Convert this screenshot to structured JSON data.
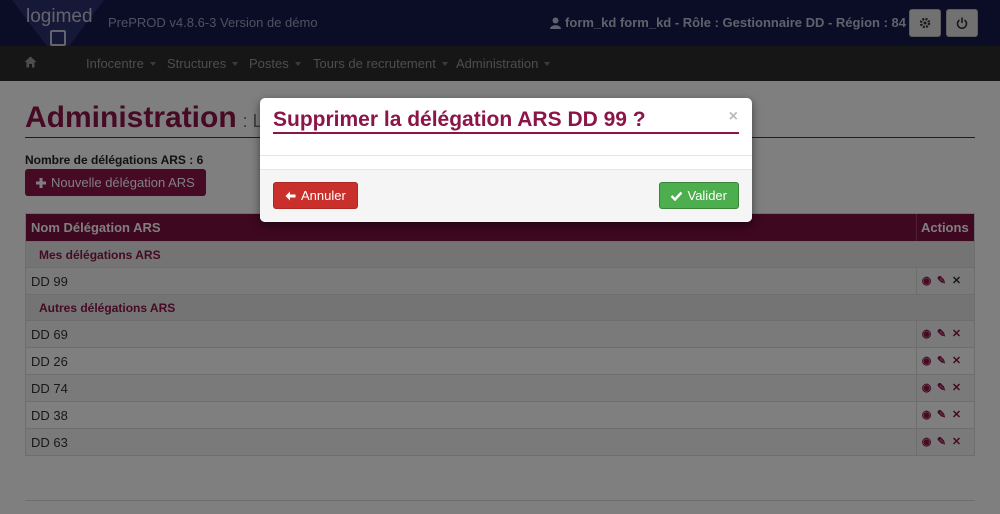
{
  "header": {
    "logo_text": "logimed",
    "version": "PrePROD v4.8.6-3 Version de démo",
    "user_info": "form_kd form_kd - Rôle : Gestionnaire DD - Région : 84",
    "settings_icon": "gear-icon",
    "logout_icon": "power-icon"
  },
  "nav": {
    "home_icon": "home-icon",
    "items": [
      {
        "label": "Infocentre"
      },
      {
        "label": "Structures"
      },
      {
        "label": "Postes"
      },
      {
        "label": "Tours de recrutement"
      },
      {
        "label": "Administration"
      }
    ]
  },
  "page": {
    "title": "Administration",
    "subtitle": ": Lis",
    "count_label": "Nombre de délégations ARS : 6",
    "new_button": "Nouvelle délégation ARS"
  },
  "table": {
    "headers": {
      "name": "Nom Délégation ARS",
      "actions": "Actions"
    },
    "groups": [
      {
        "label": "Mes délégations ARS",
        "rows": [
          "DD 99"
        ]
      },
      {
        "label": "Autres délégations ARS",
        "rows": [
          "DD 69",
          "DD 26",
          "DD 74",
          "DD 38",
          "DD 63"
        ]
      }
    ],
    "action_icons": [
      "eye-icon",
      "edit-icon",
      "delete-icon"
    ]
  },
  "modal": {
    "title": "Supprimer la délégation ARS DD 99 ?",
    "close": "×",
    "cancel": "Annuler",
    "confirm": "Valider"
  },
  "colors": {
    "brand": "#8c1548",
    "header": "#141a4a",
    "nav": "#2d2d2d",
    "danger": "#c9302c",
    "success": "#4cae4c"
  }
}
